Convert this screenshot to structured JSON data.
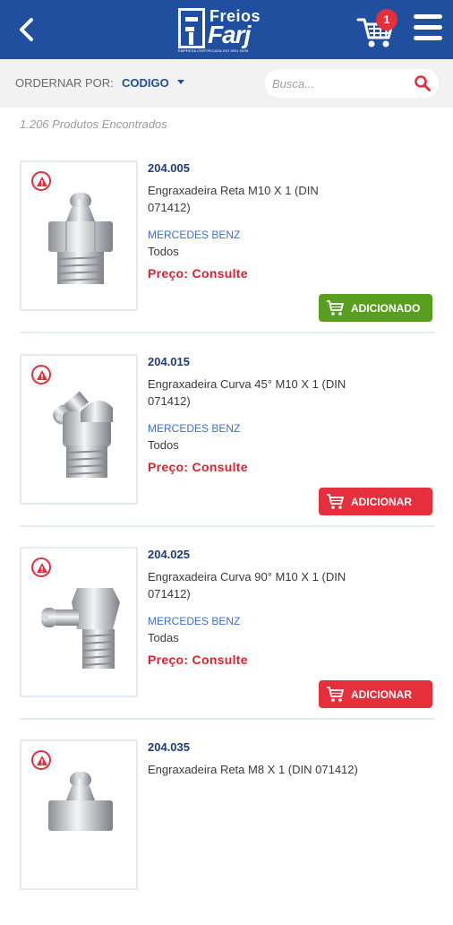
{
  "header": {
    "logo": {
      "top": "Freios",
      "main": "Farj",
      "tagline": "EMPRESA CERTIFICADA ISO 9001:2008"
    },
    "cart_count": "1",
    "colors": {
      "brand": "#1f4f9e",
      "badge": "#e52f3c"
    }
  },
  "toolbar": {
    "sort_label": "ORDERNAR POR:",
    "sort_value": "CODIGO",
    "search_placeholder": "Busca..."
  },
  "results": {
    "count_text": "1.206 Produtos Encontrados"
  },
  "products": [
    {
      "code": "204.005",
      "desc": "Engraxadeira Reta M10 X 1 (DIN 071412)",
      "brand": "MERCEDES BENZ",
      "application": "Todos",
      "price": "Preço: Consulte",
      "button": "ADICIONADO",
      "button_state": "added",
      "image_icon": "grease-fitting-straight-icon"
    },
    {
      "code": "204.015",
      "desc": "Engraxadeira Curva 45° M10 X 1 (DIN 071412)",
      "brand": "MERCEDES BENZ",
      "application": "Todos",
      "price": "Preço: Consulte",
      "button": "ADICIONAR",
      "button_state": "add",
      "image_icon": "grease-fitting-45-icon"
    },
    {
      "code": "204.025",
      "desc": "Engraxadeira Curva 90° M10 X 1 (DIN 071412)",
      "brand": "MERCEDES BENZ",
      "application": "Todas",
      "price": "Preço: Consulte",
      "button": "ADICIONAR",
      "button_state": "add",
      "image_icon": "grease-fitting-90-icon"
    },
    {
      "code": "204.035",
      "desc": "Engraxadeira Reta M8 X 1 (DIN 071412)",
      "brand": "",
      "application": "",
      "price": "",
      "button": "",
      "button_state": "hidden",
      "image_icon": "grease-fitting-straight-icon"
    }
  ],
  "colors": {
    "added_green": "#5a9e1f",
    "add_red": "#e52f3c",
    "price_red": "#e0202e",
    "brand_link": "#3b6fd4"
  }
}
